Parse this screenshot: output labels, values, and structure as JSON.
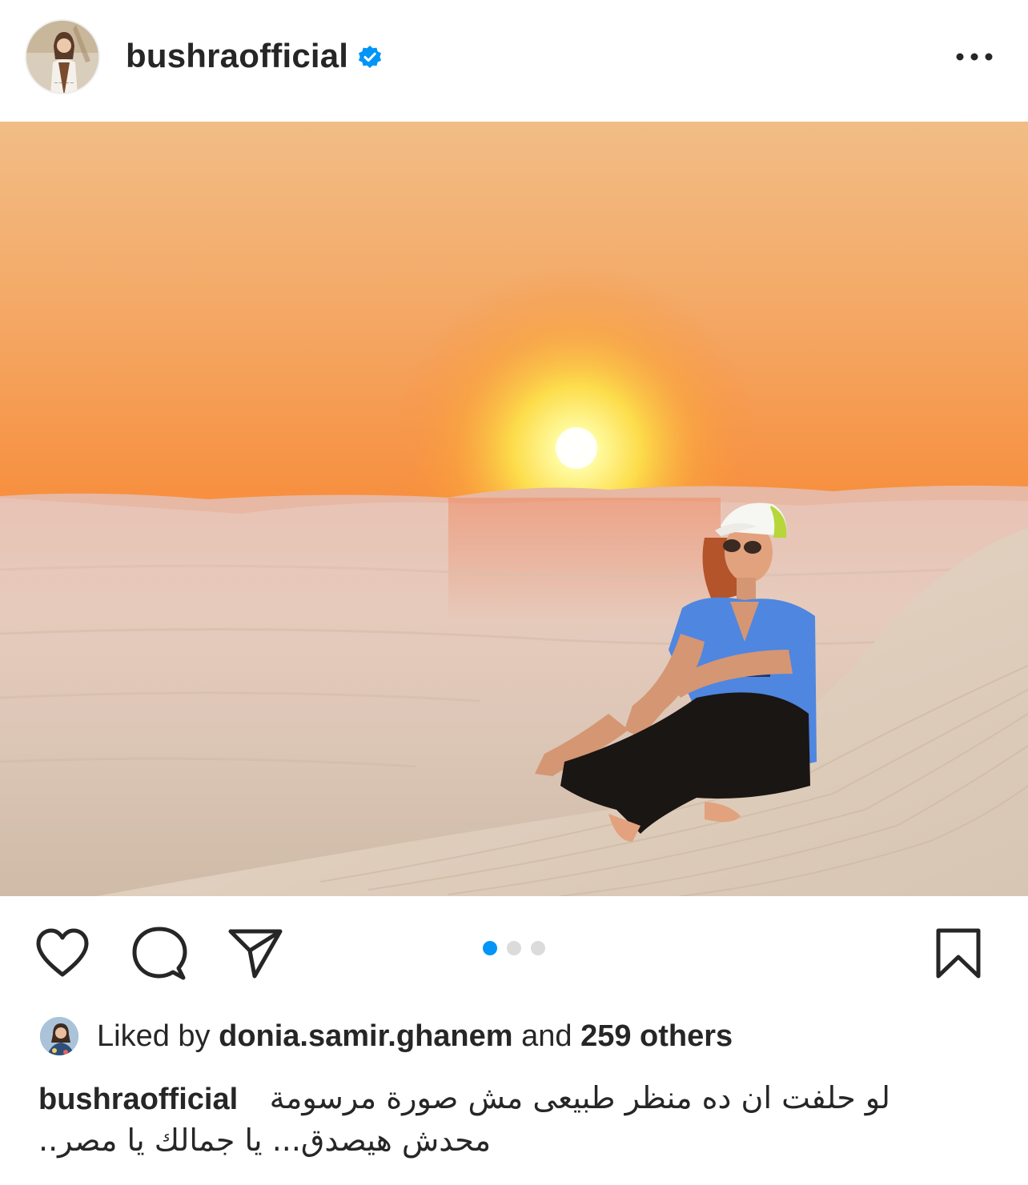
{
  "post": {
    "username": "bushraofficial",
    "verified": true,
    "more_icon": "more-horizontal-icon"
  },
  "photo": {
    "description_colors": {
      "sky_top": "#f0b87c",
      "sky_mid": "#f7923a",
      "sky_horizon": "#f46b22",
      "sun": "#fff7a8",
      "sand": "#e2cbb8",
      "shirt": "#4f86e0"
    }
  },
  "actions": {
    "like_icon": "heart-icon",
    "comment_icon": "comment-icon",
    "share_icon": "send-icon",
    "save_icon": "bookmark-icon"
  },
  "carousel": {
    "total": 3,
    "active_index": 0,
    "active_color": "#0095f6",
    "inactive_color": "#dbdbdb"
  },
  "likes": {
    "prefix": "Liked by",
    "liker": "donia.samir.ghanem",
    "middle": "and",
    "others": "259 others"
  },
  "caption": {
    "username": "bushraofficial",
    "line1": "لو حلفت ان ده منظر طبيعى مش صورة مرسومة",
    "line2": "محدش هيصدق... يا جمالك يا مصر.."
  }
}
